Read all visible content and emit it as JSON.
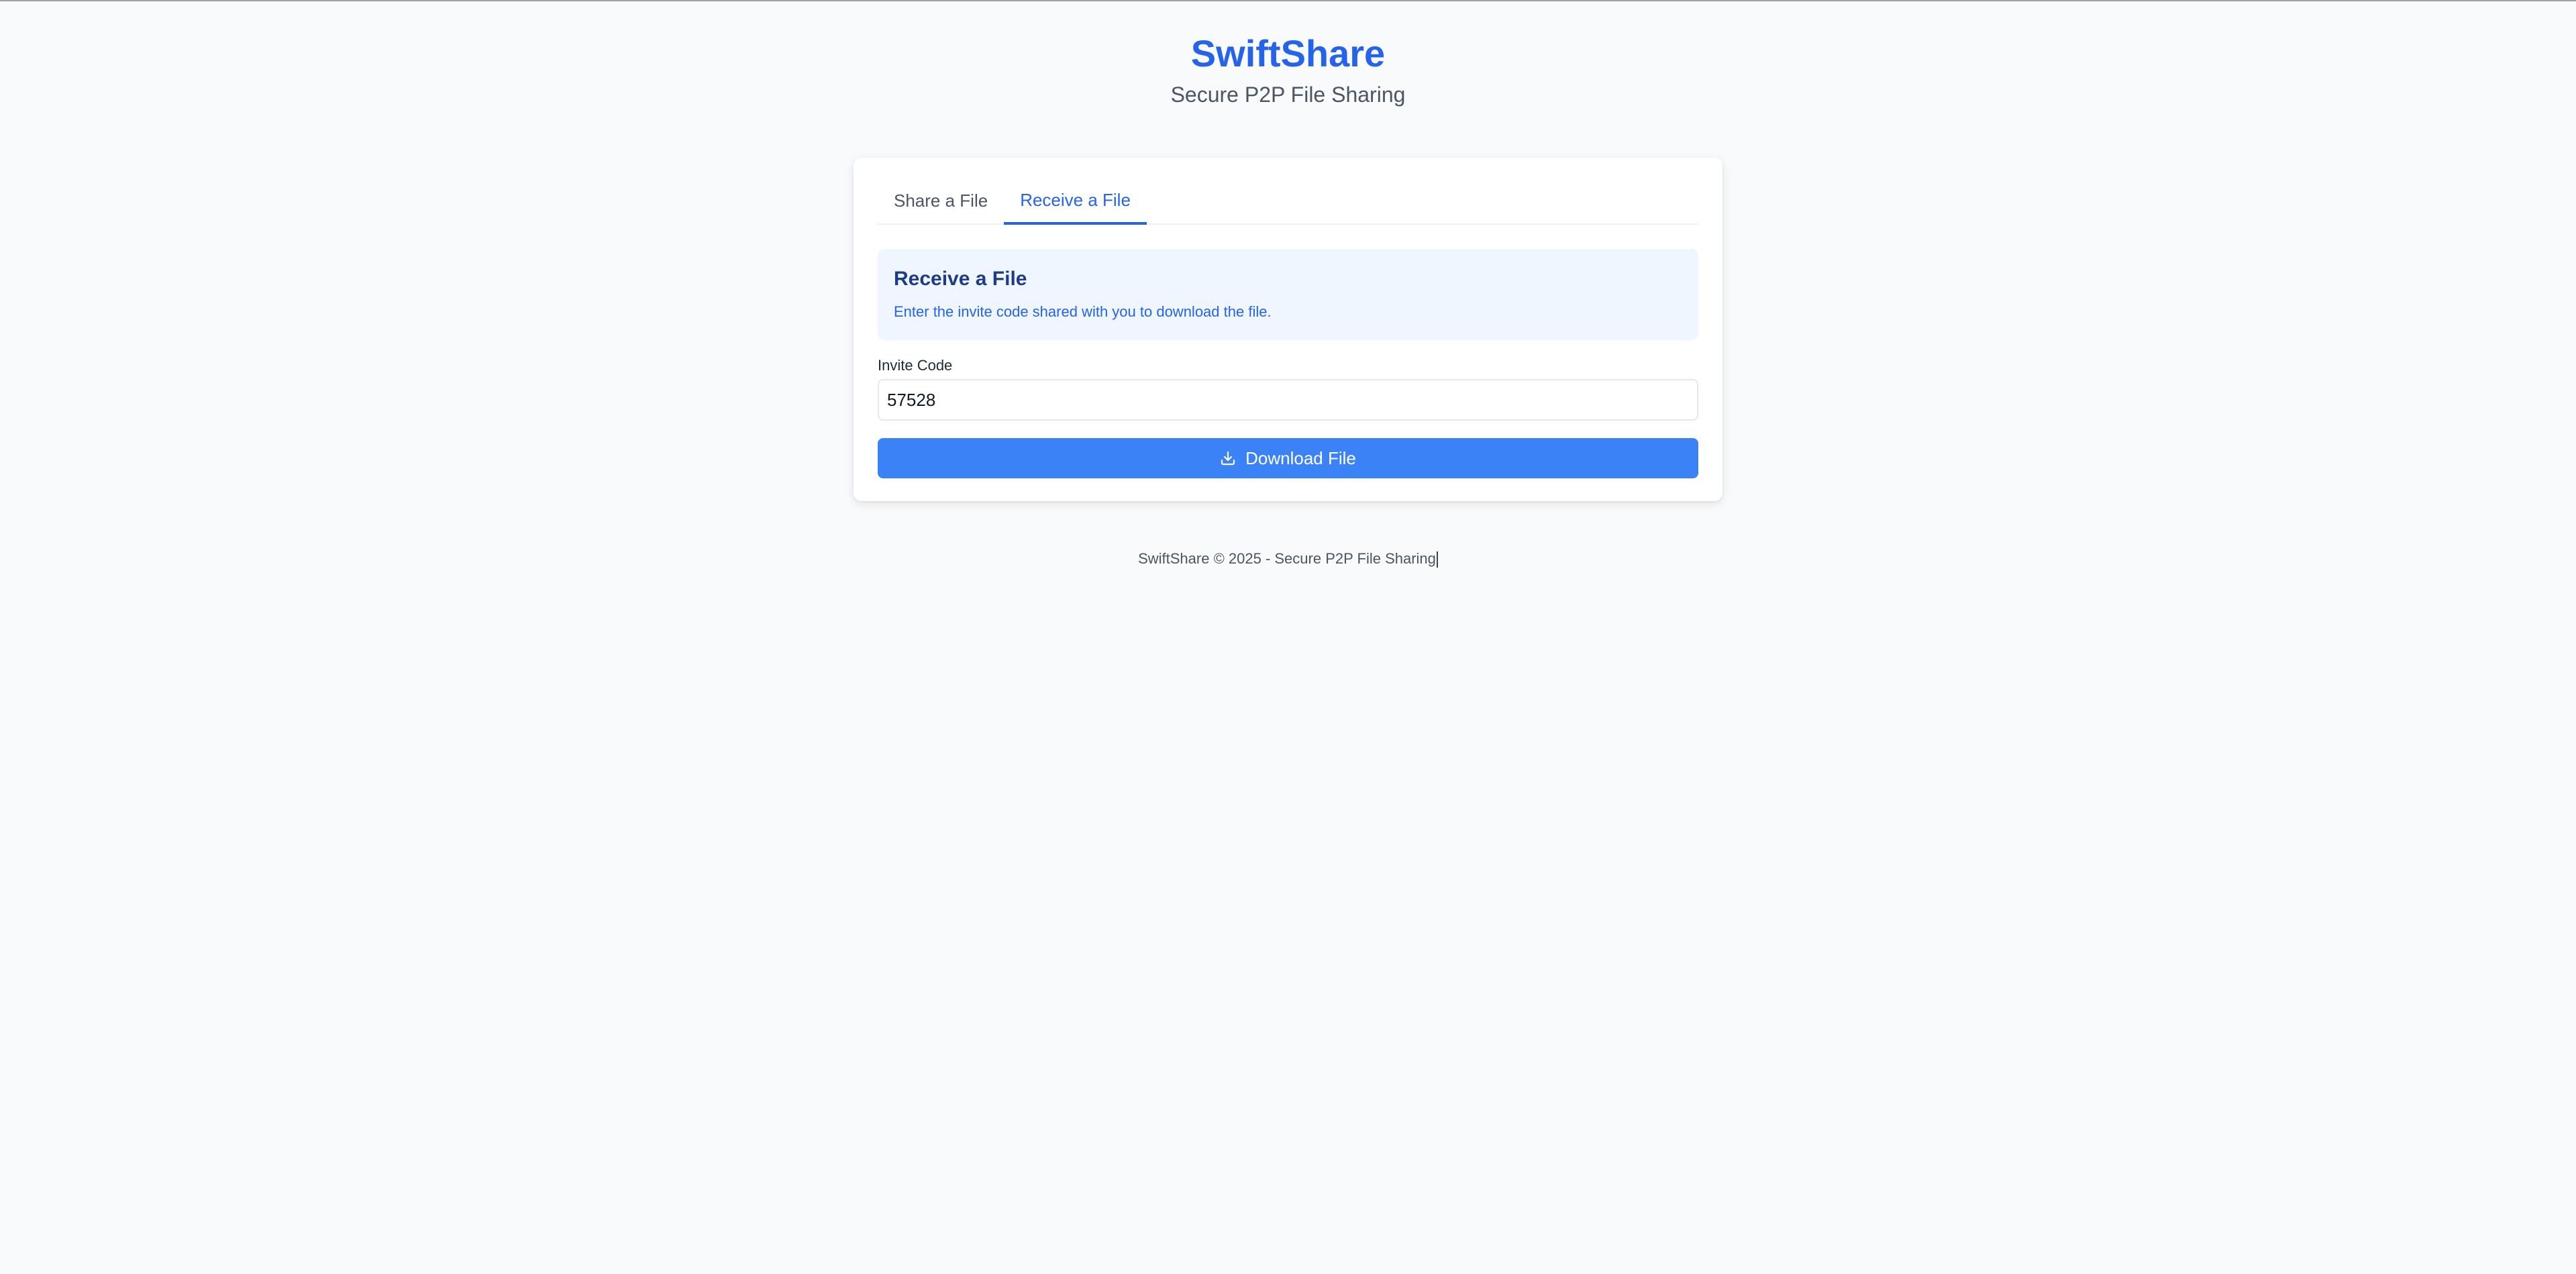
{
  "header": {
    "title": "SwiftShare",
    "subtitle": "Secure P2P File Sharing"
  },
  "tabs": [
    {
      "label": "Share a File",
      "active": false
    },
    {
      "label": "Receive a File",
      "active": true
    }
  ],
  "receive": {
    "heading": "Receive a File",
    "description": "Enter the invite code shared with you to download the file.",
    "invite_label": "Invite Code",
    "invite_value": "57528",
    "download_label": "Download File",
    "download_icon": "download-icon"
  },
  "footer": {
    "text": "SwiftShare © 2025 - Secure P2P File Sharing"
  },
  "colors": {
    "brand": "#2563eb",
    "button": "#3b82f6",
    "info_bg": "#eff6ff",
    "page_bg": "#f8fafc"
  }
}
